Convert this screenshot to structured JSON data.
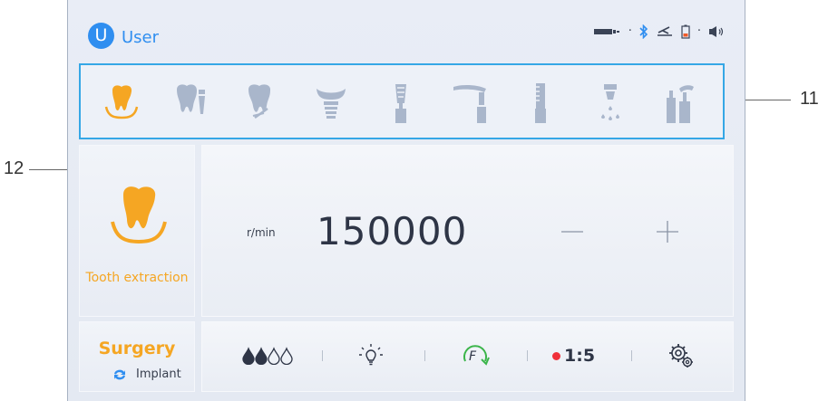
{
  "callouts": {
    "label_11": "11",
    "label_12": "12"
  },
  "header": {
    "user_initial": "U",
    "user_label": "User",
    "status_icons": [
      "handpiece-connected-icon",
      "bluetooth-icon",
      "foot-pedal-icon",
      "battery-low-icon",
      "volume-icon"
    ]
  },
  "toolbar": {
    "tools": [
      "tooth-extraction",
      "tooth-implant",
      "tooth-scaling",
      "implant-abutment",
      "bur-straight",
      "contra-angle",
      "saw",
      "spray",
      "handpiece-set"
    ],
    "selected": "tooth-extraction"
  },
  "mode": {
    "label": "Tooth extraction"
  },
  "speed": {
    "unit": "r/min",
    "value": "150000",
    "minus_icon": "minus-icon",
    "plus_icon": "plus-icon"
  },
  "procedure": {
    "name": "Surgery",
    "sub_label": "Implant"
  },
  "controls": {
    "coolant_level": 2,
    "coolant_max": 4,
    "light_icon": "light-icon",
    "direction_label": "F",
    "ratio": "1:5",
    "settings_icon": "settings-icon"
  },
  "colors": {
    "accent": "#f5a623",
    "primary": "#2f8ef0",
    "highlight_border": "#35a7e6",
    "direction": "#3bb54a",
    "ratio_dot": "#f0303a",
    "tool_inactive": "#a9b6cb"
  }
}
